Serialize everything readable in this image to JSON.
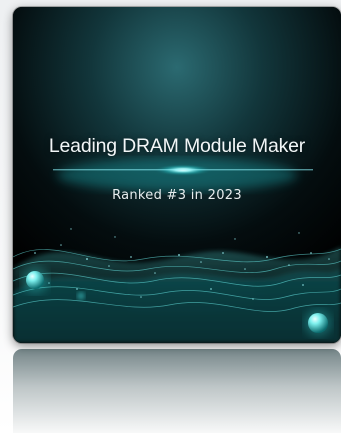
{
  "banner": {
    "headline": "Leading DRAM Module Maker",
    "subline": "Ranked #3 in 2023"
  },
  "colors": {
    "background_top": "#1c4f56",
    "background_bottom": "#000000",
    "accent_glow": "#7ff7ff",
    "particle": "#3fd6d8"
  }
}
